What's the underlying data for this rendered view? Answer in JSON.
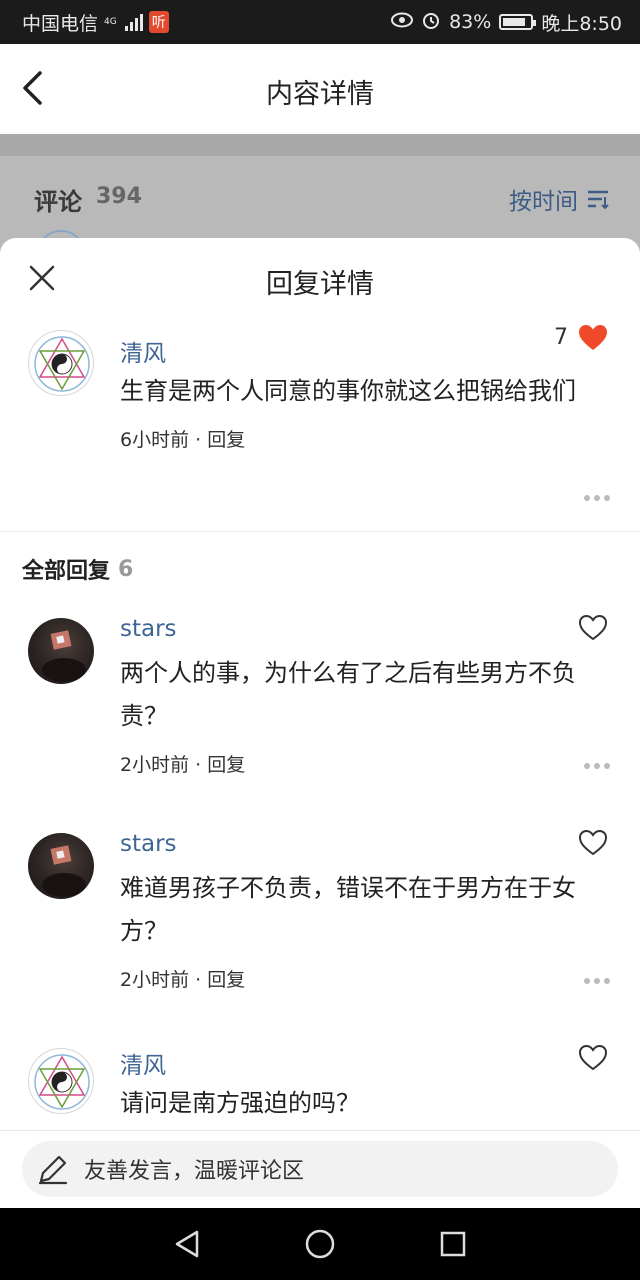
{
  "status_bar": {
    "carrier": "中国电信",
    "network": "4G",
    "app_badge": "听",
    "battery": "83%",
    "battery_level": 0.83,
    "time": "晚上8:50"
  },
  "header": {
    "title": "内容详情"
  },
  "background": {
    "comments_label": "评论",
    "comments_count": "394",
    "sort_label": "按时间"
  },
  "sheet": {
    "title": "回复详情"
  },
  "main_comment": {
    "user": "清风",
    "likes": "7",
    "text": "生育是两个人同意的事你就这么把锅给我们",
    "time": "6小时前",
    "reply_label": "回复"
  },
  "all_replies": {
    "label": "全部回复",
    "count": "6"
  },
  "replies": [
    {
      "user": "stars",
      "text": "两个人的事，为什么有了之后有些男方不负责？",
      "time": "2小时前",
      "reply_label": "回复",
      "avatar": "photo"
    },
    {
      "user": "stars",
      "text": "难道男孩子不负责，错误不在于男方在于女方？",
      "time": "2小时前",
      "reply_label": "回复",
      "avatar": "photo"
    },
    {
      "user": "清风",
      "text": "请问是南方强迫的吗？",
      "time": "",
      "reply_label": "",
      "avatar": "hex"
    }
  ],
  "input": {
    "placeholder": "友善发言，温暖评论区"
  },
  "colors": {
    "accent_blue": "#3e6694",
    "like_red": "#f04a2a"
  }
}
